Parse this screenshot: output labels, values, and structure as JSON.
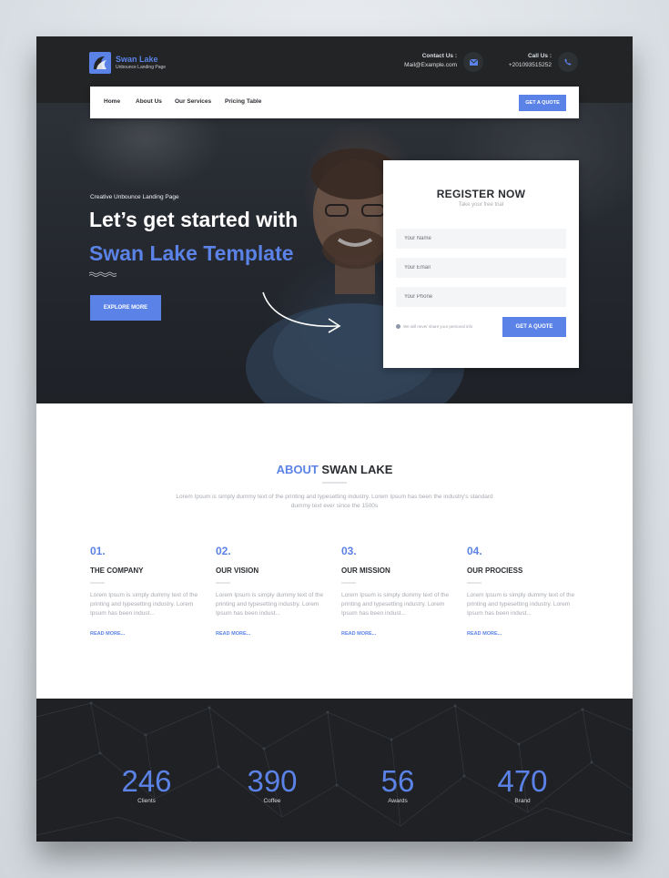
{
  "brand": {
    "name": "Swan Lake",
    "tagline": "Unbounce Landing Page"
  },
  "contact": {
    "mail_label": "Contact Us :",
    "mail_value": "Mail@Example.com",
    "call_label": "Call Us :",
    "call_value": "+201093515252"
  },
  "nav": {
    "items": [
      "Home",
      "About Us",
      "Our Services",
      "Pricing Table"
    ],
    "quote_label": "GET A QUOTE"
  },
  "hero": {
    "eyebrow": "Creative Unbounce Landing Page",
    "headline_1": "Let’s get started with",
    "headline_2": "Swan Lake Template",
    "cta_label": "EXPLORE MORE"
  },
  "register": {
    "title": "REGISTER NOW",
    "subtitle": "Take your free trial",
    "name_placeholder": "Your Name",
    "email_placeholder": "Your Email",
    "phone_placeholder": "Your Phone",
    "privacy_note": "We will never share your personal info",
    "submit_label": "GET A QUOTE"
  },
  "about": {
    "title_accent": "ABOUT",
    "title_rest": " SWAN LAKE",
    "description": "Lorem Ipsum is simply dummy text of the printing and typesetting industry. Lorem Ipsum has been the industry's standard dummy text ever since the 1500s",
    "columns": [
      {
        "num": "01.",
        "title": "THE COMPANY",
        "text": "Lorem Ipsum is simply dummy text of the printing and typesetting industry. Lorem Ipsum has been indust...",
        "read": "READ MORE..."
      },
      {
        "num": "02.",
        "title": "OUR VISION",
        "text": "Lorem Ipsum is simply dummy text of the printing and typesetting industry. Lorem Ipsum has been indust...",
        "read": "READ MORE..."
      },
      {
        "num": "03.",
        "title": "OUR MISSION",
        "text": "Lorem Ipsum is simply dummy text of the printing and typesetting industry. Lorem Ipsum has been indust...",
        "read": "READ MORE..."
      },
      {
        "num": "04.",
        "title": "OUR PROCIESS",
        "text": "Lorem Ipsum is simply dummy text of the printing and typesetting industry. Lorem Ipsum has been indust...",
        "read": "READ MORE..."
      }
    ]
  },
  "stats": [
    {
      "value": "246",
      "label": "Clients"
    },
    {
      "value": "390",
      "label": "Coffee"
    },
    {
      "value": "56",
      "label": "Awards"
    },
    {
      "value": "470",
      "label": "Brand"
    }
  ],
  "colors": {
    "accent": "#5b82e6",
    "dark": "#222426",
    "stats_bg": "#1f2124"
  },
  "icons": {
    "mail": "envelope-icon",
    "phone": "phone-icon",
    "info": "info-icon"
  }
}
